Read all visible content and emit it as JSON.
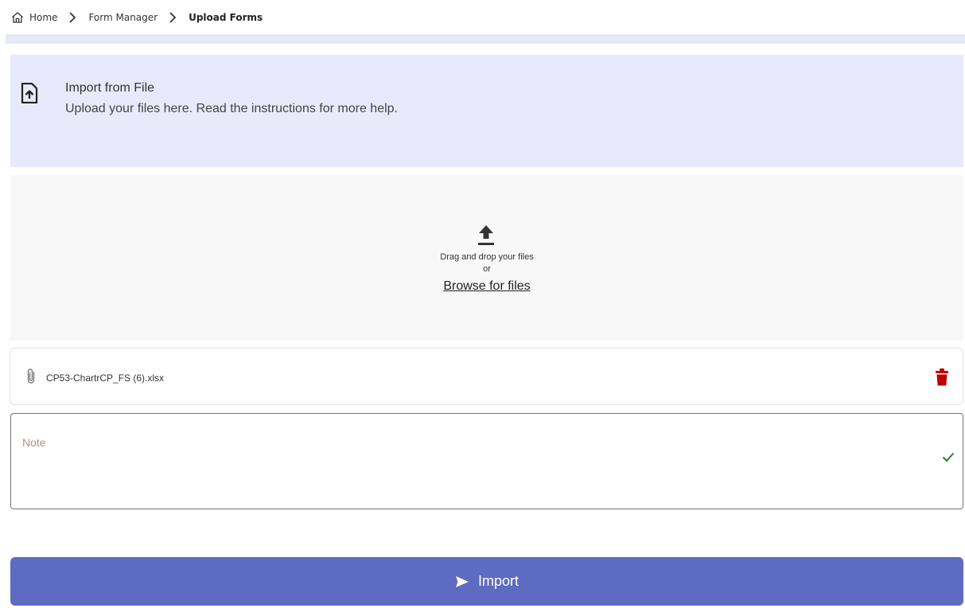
{
  "breadcrumb": {
    "home": "Home",
    "form_manager": "Form Manager",
    "current": "Upload Forms"
  },
  "info_panel": {
    "icon": "file-upload-icon",
    "title": "Import from File",
    "description": "Upload your files here. Read the instructions for more help."
  },
  "dropzone": {
    "icon": "upload-arrow-icon",
    "drag_text": "Drag and drop your files",
    "or_text": "or",
    "browse_label": "Browse for files"
  },
  "file": {
    "icon": "paperclip-icon",
    "name": "CP53-ChartrCP_FS (6).xlsx",
    "delete_icon": "trash-icon",
    "delete_color": "#c00000"
  },
  "note": {
    "placeholder": "Note",
    "value": "",
    "status_icon": "check-icon",
    "status_color": "#2e7d32"
  },
  "import_button": {
    "label": "Import",
    "icon": "send-icon",
    "color": "#5d6bc0"
  }
}
